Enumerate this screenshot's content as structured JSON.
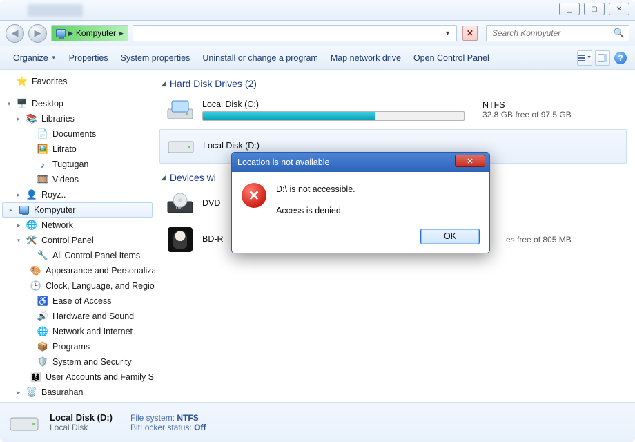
{
  "window": {
    "title_controls": {
      "min": "▁",
      "max": "▢",
      "close": "✕"
    }
  },
  "nav": {
    "back_glyph": "◀",
    "fwd_glyph": "▶",
    "breadcrumb_label": "Kompyuter",
    "breadcrumb_sep": "▶",
    "clear_glyph": "✕",
    "dropdown_glyph": "▼",
    "search_placeholder": "Search Kompyuter",
    "search_glyph": "🔍"
  },
  "cmdbar": {
    "organize": "Organize",
    "properties": "Properties",
    "system_properties": "System properties",
    "uninstall": "Uninstall or change a program",
    "map_drive": "Map network drive",
    "open_cp": "Open Control Panel",
    "dropdown_glyph": "▼",
    "help_glyph": "?"
  },
  "sidebar": {
    "favorites": "Favorites",
    "desktop": "Desktop",
    "libraries": "Libraries",
    "documents": "Documents",
    "litrato": "Litrato",
    "tugtugan": "Tugtugan",
    "videos": "Videos",
    "royz": "Royz..",
    "kompyuter": "Kompyuter",
    "network": "Network",
    "control_panel": "Control Panel",
    "cp_all": "All Control Panel Items",
    "cp_appearance": "Appearance and Personaliza",
    "cp_clock": "Clock, Language, and Regio",
    "cp_ease": "Ease of Access",
    "cp_hw": "Hardware and Sound",
    "cp_net": "Network and Internet",
    "cp_programs": "Programs",
    "cp_security": "System and Security",
    "cp_users": "User Accounts and Family S",
    "basurahan": "Basurahan"
  },
  "groups": {
    "hdd": "Hard Disk Drives (2)",
    "devices": "Devices wi"
  },
  "drives": {
    "c": {
      "name": "Local Disk (C:)",
      "fs": "NTFS",
      "free": "32.8 GB free of 97.5 GB",
      "fill_pct": 66
    },
    "d": {
      "name": "Local Disk (D:)",
      "fs": "",
      "free": ""
    },
    "dvd": {
      "name": "DVD"
    },
    "bdr": {
      "name": "BD-R",
      "free_tail": "es free of 805 MB"
    }
  },
  "details": {
    "name": "Local Disk (D:)",
    "type": "Local Disk",
    "fs_label": "File system:",
    "fs_value": "NTFS",
    "bl_label": "BitLocker status:",
    "bl_value": "Off"
  },
  "dialog": {
    "title": "Location is not available",
    "line1": "D:\\ is not accessible.",
    "line2": "Access is denied.",
    "ok": "OK",
    "close_glyph": "✕",
    "err_glyph": "✕"
  }
}
